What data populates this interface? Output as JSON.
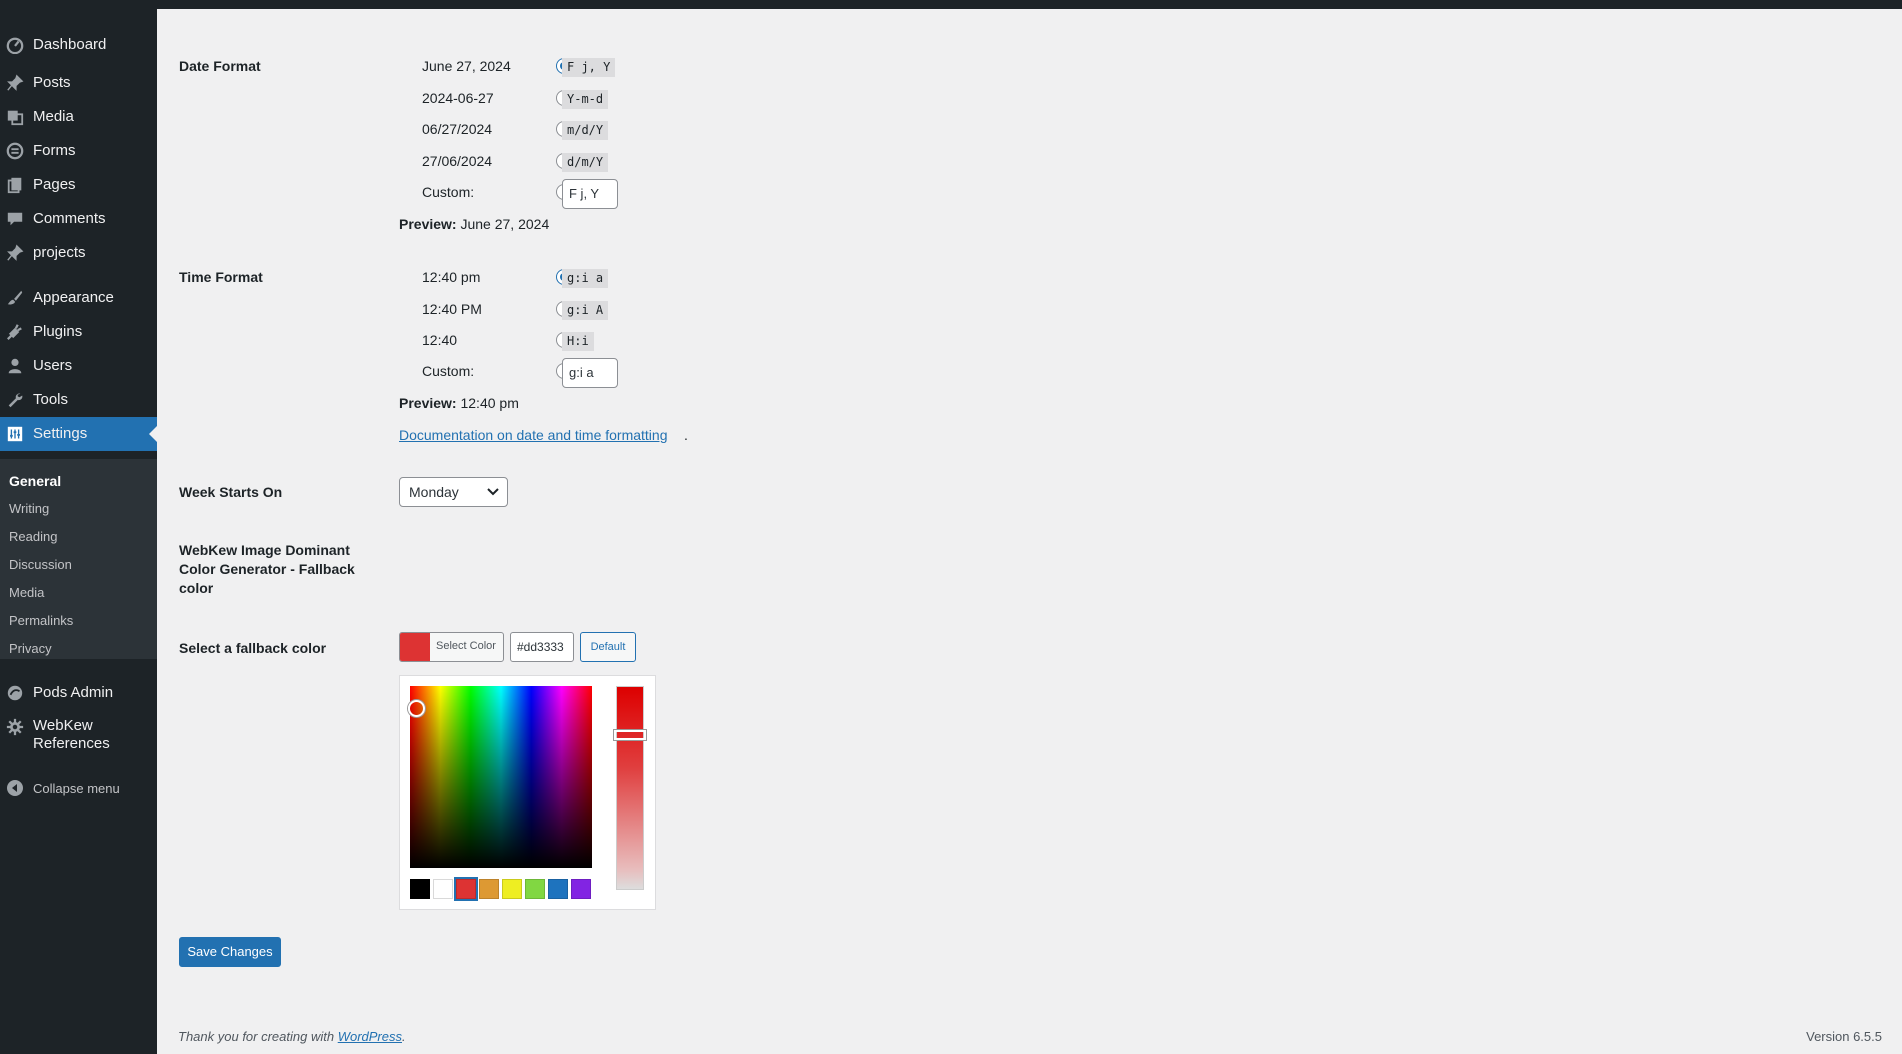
{
  "sidebar": {
    "items": [
      {
        "label": "Dashboard",
        "icon": "dashboard-icon"
      },
      {
        "label": "Posts",
        "icon": "pin-icon"
      },
      {
        "label": "Media",
        "icon": "media-icon"
      },
      {
        "label": "Forms",
        "icon": "forms-icon"
      },
      {
        "label": "Pages",
        "icon": "pages-icon"
      },
      {
        "label": "Comments",
        "icon": "comment-icon"
      },
      {
        "label": "projects",
        "icon": "pin-icon"
      },
      {
        "label": "Appearance",
        "icon": "brush-icon"
      },
      {
        "label": "Plugins",
        "icon": "plug-icon"
      },
      {
        "label": "Users",
        "icon": "user-icon"
      },
      {
        "label": "Tools",
        "icon": "wrench-icon"
      },
      {
        "label": "Settings",
        "icon": "settings-icon"
      }
    ],
    "submenu": [
      "General",
      "Writing",
      "Reading",
      "Discussion",
      "Media",
      "Permalinks",
      "Privacy"
    ],
    "extra_items": [
      {
        "label": "Pods Admin",
        "icon": "pods-icon"
      },
      {
        "label": "WebKew References",
        "icon": "gear-icon"
      }
    ],
    "collapse_label": "Collapse menu"
  },
  "date_format": {
    "label": "Date Format",
    "options": [
      {
        "text": "June 27, 2024",
        "code": "F j, Y"
      },
      {
        "text": "2024-06-27",
        "code": "Y-m-d"
      },
      {
        "text": "06/27/2024",
        "code": "m/d/Y"
      },
      {
        "text": "27/06/2024",
        "code": "d/m/Y"
      }
    ],
    "custom_label": "Custom:",
    "custom_value": "F j, Y",
    "preview_label": "Preview:",
    "preview_value": "June 27, 2024"
  },
  "time_format": {
    "label": "Time Format",
    "options": [
      {
        "text": "12:40 pm",
        "code": "g:i a"
      },
      {
        "text": "12:40 PM",
        "code": "g:i A"
      },
      {
        "text": "12:40",
        "code": "H:i"
      }
    ],
    "custom_label": "Custom:",
    "custom_value": "g:i a",
    "preview_label": "Preview:",
    "preview_value": "12:40 pm"
  },
  "doc_link": "Documentation on date and time formatting",
  "week_starts": {
    "label": "Week Starts On",
    "value": "Monday"
  },
  "webkew_heading": "WebKew Image Dominant Color Generator - Fallback color",
  "fallback": {
    "label": "Select a fallback color",
    "select_color_label": "Select Color",
    "hex_value": "#dd3333",
    "default_label": "Default",
    "current_color": "#dd3333",
    "palette": [
      "#000000",
      "#ffffff",
      "#dd3333",
      "#dd9933",
      "#eeee22",
      "#81d742",
      "#1e73be",
      "#8224e3"
    ]
  },
  "save_label": "Save Changes",
  "footer": {
    "thanks_prefix": "Thank you for creating with ",
    "thanks_link": "WordPress",
    "thanks_suffix": ".",
    "version": "Version 6.5.5"
  },
  "colors": {
    "accent": "#2271b1",
    "sidebar_bg": "#1d2327"
  }
}
